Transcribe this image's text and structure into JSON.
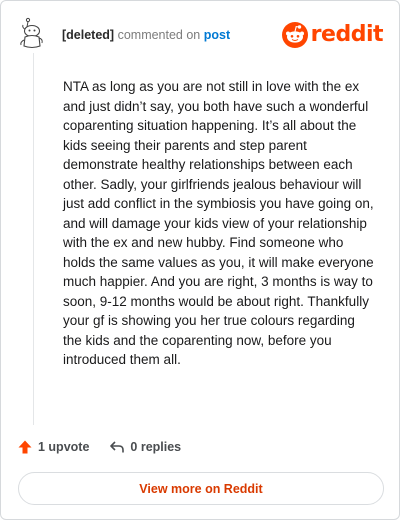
{
  "header": {
    "username": "[deleted]",
    "action_text": "commented on",
    "post_link": "post"
  },
  "logo": {
    "wordmark": "reddit",
    "icon": "reddit-snoo-icon",
    "color": "#ff4500"
  },
  "comment": {
    "body": "NTA as long as you are not still in love with the ex and just didn’t say, you both have such a wonderful coparenting situation happening. It’s all about the kids seeing their parents and step parent demonstrate healthy relationships between each other. Sadly, your girlfriends jealous behaviour will just add conflict in the symbiosis you have going on, and will damage your kids view of your relationship with the ex and new hubby. Find someone who holds the same values as you, it will make everyone much happier. And you are right, 3 months is way to soon, 9-12 months would be about right. Thankfully your gf is showing you her true colours regarding the kids and the coparenting now, before you introduced them all."
  },
  "actions": {
    "upvote_label": "1 upvote",
    "upvote_icon": "arrow-up-icon",
    "upvote_color": "#ff4500",
    "replies_label": "0 replies",
    "replies_icon": "reply-icon"
  },
  "footer": {
    "view_more_label": "View more on Reddit",
    "accent": "#d93a00"
  }
}
